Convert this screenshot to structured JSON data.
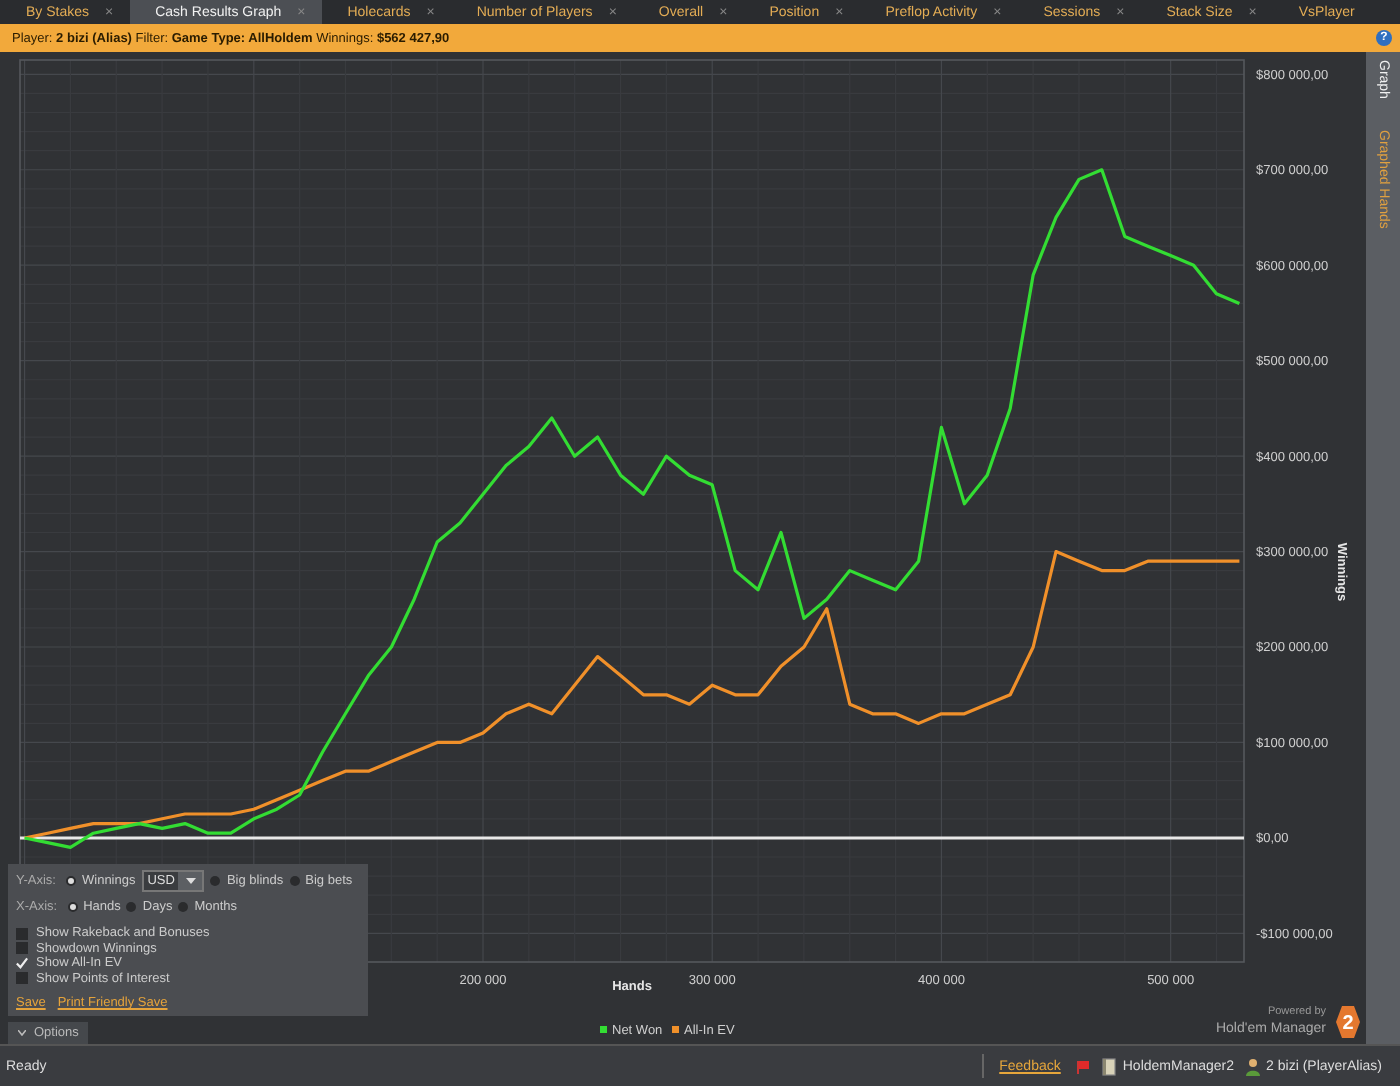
{
  "tabs": [
    {
      "label": "By Stakes",
      "selected": false,
      "close": "×"
    },
    {
      "label": "Cash Results Graph",
      "selected": true,
      "close": "×"
    },
    {
      "label": "Holecards",
      "selected": false,
      "close": "×"
    },
    {
      "label": "Number of Players",
      "selected": false,
      "close": "×"
    },
    {
      "label": "Overall",
      "selected": false,
      "close": "×"
    },
    {
      "label": "Position",
      "selected": false,
      "close": "×"
    },
    {
      "label": "Preflop Activity",
      "selected": false,
      "close": "×"
    },
    {
      "label": "Sessions",
      "selected": false,
      "close": "×"
    },
    {
      "label": "Stack Size",
      "selected": false,
      "close": "×"
    },
    {
      "label": "VsPlayer",
      "selected": false
    }
  ],
  "filter_bar": {
    "text": "Player: **2 bizi (Alias)** Filter: **Game Type: AllHoldem** Winnings: **$562 427,90**",
    "help": "?"
  },
  "chart": {
    "chart_data": {
      "type": "line",
      "xlabel": "Hands",
      "ylabel": "Winnings",
      "x": [
        0,
        10000,
        20000,
        30000,
        40000,
        50000,
        60000,
        70000,
        80000,
        90000,
        100000,
        110000,
        120000,
        130000,
        140000,
        150000,
        160000,
        170000,
        180000,
        190000,
        200000,
        210000,
        220000,
        230000,
        240000,
        250000,
        260000,
        270000,
        280000,
        290000,
        300000,
        310000,
        320000,
        330000,
        340000,
        350000,
        360000,
        370000,
        380000,
        390000,
        400000,
        410000,
        420000,
        430000,
        440000,
        450000,
        460000,
        470000,
        480000,
        490000,
        500000,
        510000,
        520000,
        530000
      ],
      "series": [
        {
          "name": "Net Won",
          "color": "#33dd33",
          "values": [
            0,
            -5000,
            -10000,
            5000,
            10000,
            15000,
            10000,
            15000,
            5000,
            5000,
            20000,
            30000,
            45000,
            90000,
            130000,
            170000,
            200000,
            250000,
            310000,
            330000,
            360000,
            390000,
            410000,
            440000,
            400000,
            420000,
            380000,
            360000,
            400000,
            380000,
            370000,
            280000,
            260000,
            320000,
            230000,
            250000,
            280000,
            270000,
            260000,
            290000,
            430000,
            350000,
            380000,
            450000,
            590000,
            650000,
            690000,
            700000,
            630000,
            620000,
            610000,
            600000,
            570000,
            560000
          ]
        },
        {
          "name": "All-In EV",
          "color": "#f0902a",
          "values": [
            0,
            5000,
            10000,
            15000,
            15000,
            15000,
            20000,
            25000,
            25000,
            25000,
            30000,
            40000,
            50000,
            60000,
            70000,
            70000,
            80000,
            90000,
            100000,
            100000,
            110000,
            130000,
            140000,
            130000,
            160000,
            190000,
            170000,
            150000,
            150000,
            140000,
            160000,
            150000,
            150000,
            180000,
            200000,
            240000,
            140000,
            130000,
            130000,
            120000,
            130000,
            130000,
            140000,
            150000,
            200000,
            300000,
            290000,
            280000,
            280000,
            290000,
            290000,
            290000,
            290000,
            290000
          ]
        }
      ],
      "grid": true,
      "legend": true,
      "xlim": [
        -2000,
        532000
      ],
      "ylim": [
        -130000,
        815000
      ],
      "xticks": [
        {
          "value": 200000,
          "label": "200 000"
        },
        {
          "value": 300000,
          "label": "300 000"
        },
        {
          "value": 400000,
          "label": "400 000"
        },
        {
          "value": 500000,
          "label": "500 000"
        }
      ],
      "yticks": [
        {
          "value": 800000,
          "label": "$800 000,00"
        },
        {
          "value": 700000,
          "label": "$700 000,00"
        },
        {
          "value": 600000,
          "label": "$600 000,00"
        },
        {
          "value": 500000,
          "label": "$500 000,00"
        },
        {
          "value": 400000,
          "label": "$400 000,00"
        },
        {
          "value": 300000,
          "label": "$300 000,00"
        },
        {
          "value": 200000,
          "label": "$200 000,00"
        },
        {
          "value": 100000,
          "label": "$100 000,00"
        },
        {
          "value": 0,
          "label": "$0,00"
        },
        {
          "value": -100000,
          "label": "-$100 000,00"
        }
      ]
    },
    "branding": {
      "powered_by": "Powered by",
      "product": "Hold'em Manager",
      "badge": "2"
    }
  },
  "side_tabs": [
    {
      "label": "Graph",
      "selected": true
    },
    {
      "label": "Graphed Hands",
      "selected": false
    }
  ],
  "options_panel": {
    "y_axis": {
      "label": "Y-Axis:",
      "currency": "USD",
      "radios": [
        {
          "label": "Winnings",
          "selected": true
        },
        {
          "label": "Big blinds",
          "selected": false
        },
        {
          "label": "Big bets",
          "selected": false
        }
      ]
    },
    "x_axis": {
      "label": "X-Axis:",
      "radios": [
        {
          "label": "Hands",
          "selected": true
        },
        {
          "label": "Days",
          "selected": false
        },
        {
          "label": "Months",
          "selected": false
        }
      ]
    },
    "checkboxes": [
      {
        "label": "Show Rakeback and Bonuses",
        "checked": false
      },
      {
        "label": "Showdown Winnings",
        "checked": false
      },
      {
        "label": "Show All-In EV",
        "checked": true
      },
      {
        "label": "Show Points of Interest",
        "checked": false
      }
    ],
    "links": [
      "Save",
      "Print Friendly Save"
    ],
    "toggle": "Options"
  },
  "status_bar": {
    "text": "Ready",
    "feedback": "Feedback",
    "app": "HoldemManager2",
    "user": "2 bizi (PlayerAlias)"
  }
}
